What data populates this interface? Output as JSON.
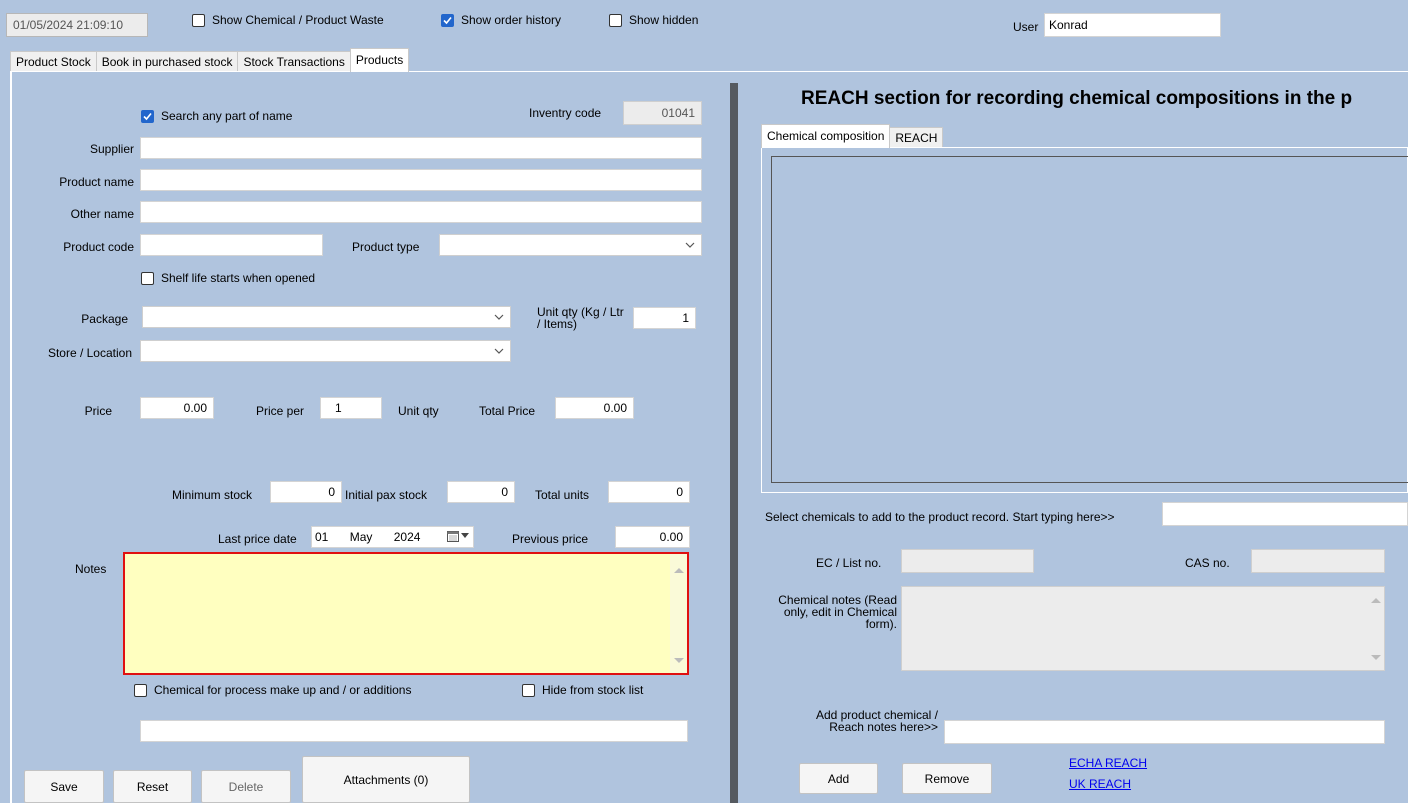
{
  "topbar": {
    "datetime": "01/05/2024 21:09:10",
    "show_waste_label": "Show Chemical / Product Waste",
    "show_waste_checked": false,
    "show_order_history_label": "Show order history",
    "show_order_history_checked": true,
    "show_hidden_label": "Show hidden",
    "show_hidden_checked": false,
    "user_label": "User",
    "user_value": "Konrad"
  },
  "tabs": [
    {
      "label": "Product Stock",
      "active": false
    },
    {
      "label": "Book in purchased stock",
      "active": false
    },
    {
      "label": "Stock Transactions",
      "active": false
    },
    {
      "label": "Products",
      "active": true
    }
  ],
  "product_form": {
    "search_any_part_label": "Search any part of name",
    "search_any_part_checked": true,
    "inventory_code_label": "Inventry code",
    "inventory_code_value": "01041",
    "supplier_label": "Supplier",
    "supplier_value": "",
    "product_name_label": "Product name",
    "product_name_value": "",
    "other_name_label": "Other name",
    "other_name_value": "",
    "product_code_label": "Product code",
    "product_code_value": "",
    "product_type_label": "Product type",
    "product_type_value": "",
    "shelf_life_label": "Shelf life starts when opened",
    "shelf_life_checked": false,
    "package_label": "Package",
    "package_value": "",
    "unit_qty_label": "Unit qty (Kg / Ltr / Items)",
    "unit_qty_value": "1",
    "store_location_label": "Store / Location",
    "store_location_value": "",
    "price_label": "Price",
    "price_value": "0.00",
    "price_per_label": "Price per",
    "price_per_value": "1",
    "unit_qty_short_label": "Unit qty",
    "total_price_label": "Total Price",
    "total_price_value": "0.00",
    "minimum_stock_label": "Minimum stock",
    "minimum_stock_value": "0",
    "initial_pax_stock_label": "Initial pax stock",
    "initial_pax_stock_value": "0",
    "total_units_label": "Total units",
    "total_units_value": "0",
    "last_price_date_label": "Last price date",
    "last_price_date_day": "01",
    "last_price_date_month": "May",
    "last_price_date_year": "2024",
    "previous_price_label": "Previous price",
    "previous_price_value": "0.00",
    "notes_label": "Notes",
    "notes_value": "",
    "chem_process_label": "Chemical for process make up and / or additions",
    "chem_process_checked": false,
    "hide_stock_label": "Hide from stock list",
    "hide_stock_checked": false,
    "extra_field_value": ""
  },
  "buttons": {
    "save": "Save",
    "reset": "Reset",
    "delete": "Delete",
    "attachments": "Attachments (0)"
  },
  "reach": {
    "title": "REACH section for recording chemical compositions in the p",
    "tabs": [
      {
        "label": "Chemical composition",
        "active": true
      },
      {
        "label": "REACH",
        "active": false
      }
    ],
    "select_chemicals_label": "Select chemicals to add to the product record. Start typing here>>",
    "select_chemicals_value": "",
    "ec_list_label": "EC / List no.",
    "ec_list_value": "",
    "cas_label": "CAS no.",
    "cas_value": "",
    "chemical_notes_label": "Chemical notes (Read only, edit in Chemical form).",
    "chemical_notes_value": "",
    "add_notes_label": "Add product chemical / Reach notes here>>",
    "add_notes_value": "",
    "add_button": "Add",
    "remove_button": "Remove",
    "echa_link": "ECHA REACH",
    "uk_link": "UK REACH"
  },
  "colors": {
    "background": "#b0c4de",
    "notes_background": "#ffffc0",
    "notes_highlight_border": "#e01010",
    "accent_check": "#2266cc",
    "link": "#0000ee"
  }
}
